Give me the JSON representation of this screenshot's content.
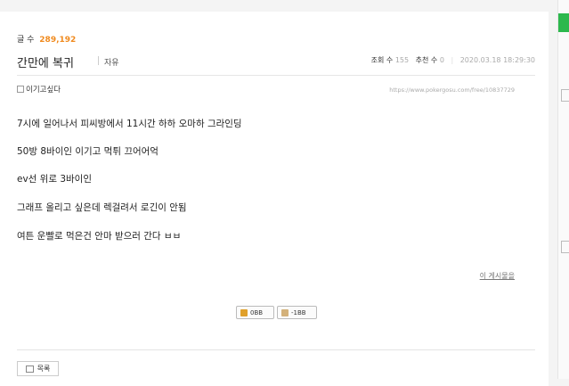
{
  "board": {
    "post_count_label": "글 수",
    "post_count": "289,192"
  },
  "post": {
    "title": "간만에 복귀",
    "category": "자유",
    "views_label": "조회 수",
    "views": "155",
    "recommend_label": "추천 수",
    "recommends": "0",
    "date": "2020.03.18 18:29:30",
    "author": "이기고싶다",
    "url": "https://www.pokergosu.com/free/10837729",
    "body": [
      "7시에 일어나서 피씨방에서 11시간 하하 오마하 그라인딩",
      "50방 8바이인 이기고 먹튀 끄어어억",
      "ev선 위로 3바이인",
      "그래프 올리고 싶은데 렉걸려서 로긴이 안됨",
      "여튼 운빨로 먹은건 안마 받으러 간다 ㅂㅂ"
    ],
    "other_posts_link": "이 게시물을"
  },
  "votes": {
    "up_label": "0BB",
    "down_label": "-1BB"
  },
  "actions": {
    "list_label": "목록"
  },
  "colors": {
    "accent_orange": "#f08a1e",
    "sidebar_green": "#2db84d"
  }
}
